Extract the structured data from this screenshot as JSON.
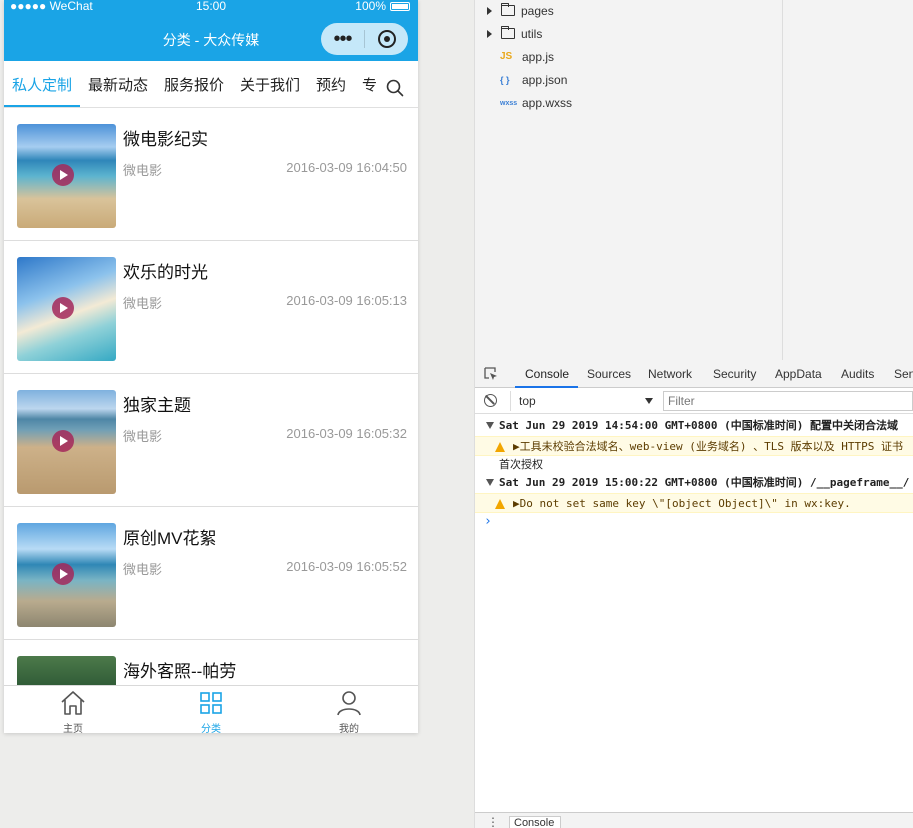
{
  "status_bar": {
    "signal": "●●●●● WeChat",
    "time": "15:00",
    "battery": "100%"
  },
  "navbar": {
    "title": "分类 - 大众传媒",
    "more": "•••"
  },
  "tabs": [
    {
      "label": "私人定制",
      "active": true
    },
    {
      "label": "最新动态",
      "active": false
    },
    {
      "label": "服务报价",
      "active": false
    },
    {
      "label": "关于我们",
      "active": false
    },
    {
      "label": "预约",
      "active": false
    },
    {
      "label": "专",
      "active": false
    }
  ],
  "videos": [
    {
      "title": "微电影纪实",
      "category": "微电影",
      "time": "2016-03-09 16:04:50"
    },
    {
      "title": "欢乐的时光",
      "category": "微电影",
      "time": "2016-03-09 16:05:13"
    },
    {
      "title": "独家主题",
      "category": "微电影",
      "time": "2016-03-09 16:05:32"
    },
    {
      "title": "原创MV花絮",
      "category": "微电影",
      "time": "2016-03-09 16:05:52"
    },
    {
      "title": "海外客照--帕劳",
      "category": "",
      "time": ""
    }
  ],
  "tabbar": [
    {
      "label": "主页",
      "icon": "home-icon",
      "active": false
    },
    {
      "label": "分类",
      "icon": "grid-icon",
      "active": true
    },
    {
      "label": "我的",
      "icon": "user-icon",
      "active": false
    }
  ],
  "file_tree": [
    {
      "name": "pages",
      "type": "folder"
    },
    {
      "name": "utils",
      "type": "folder"
    },
    {
      "name": "app.js",
      "type": "js",
      "icon_text": "JS"
    },
    {
      "name": "app.json",
      "type": "json",
      "icon_text": "{ }"
    },
    {
      "name": "app.wxss",
      "type": "wxss",
      "icon_text": "wxss"
    }
  ],
  "devtools": {
    "tabs": [
      "Console",
      "Sources",
      "Network",
      "Security",
      "AppData",
      "Audits",
      "Sen"
    ],
    "active_tab": "Console",
    "context": "top",
    "filter_placeholder": "Filter",
    "logs": [
      {
        "kind": "group",
        "text": "Sat Jun 29 2019 14:54:00 GMT+0800 (中国标准时间) 配置中关闭合法域"
      },
      {
        "kind": "warn",
        "text": "工具未校验合法域名、web-view (业务域名) 、TLS 版本以及 HTTPS 证书"
      },
      {
        "kind": "plain",
        "text": "首次授权"
      },
      {
        "kind": "group",
        "text": "Sat Jun 29 2019 15:00:22 GMT+0800 (中国标准时间) /__pageframe__/"
      },
      {
        "kind": "warn",
        "text": "Do not set same key \\\"[object Object]\\\" in wx:key."
      }
    ],
    "prompt": "›",
    "bottom_tab": "Console"
  },
  "colors": {
    "accent": "#1aa4e6",
    "warn_bg": "#fffbe5",
    "link_blue": "#1a73e8"
  }
}
